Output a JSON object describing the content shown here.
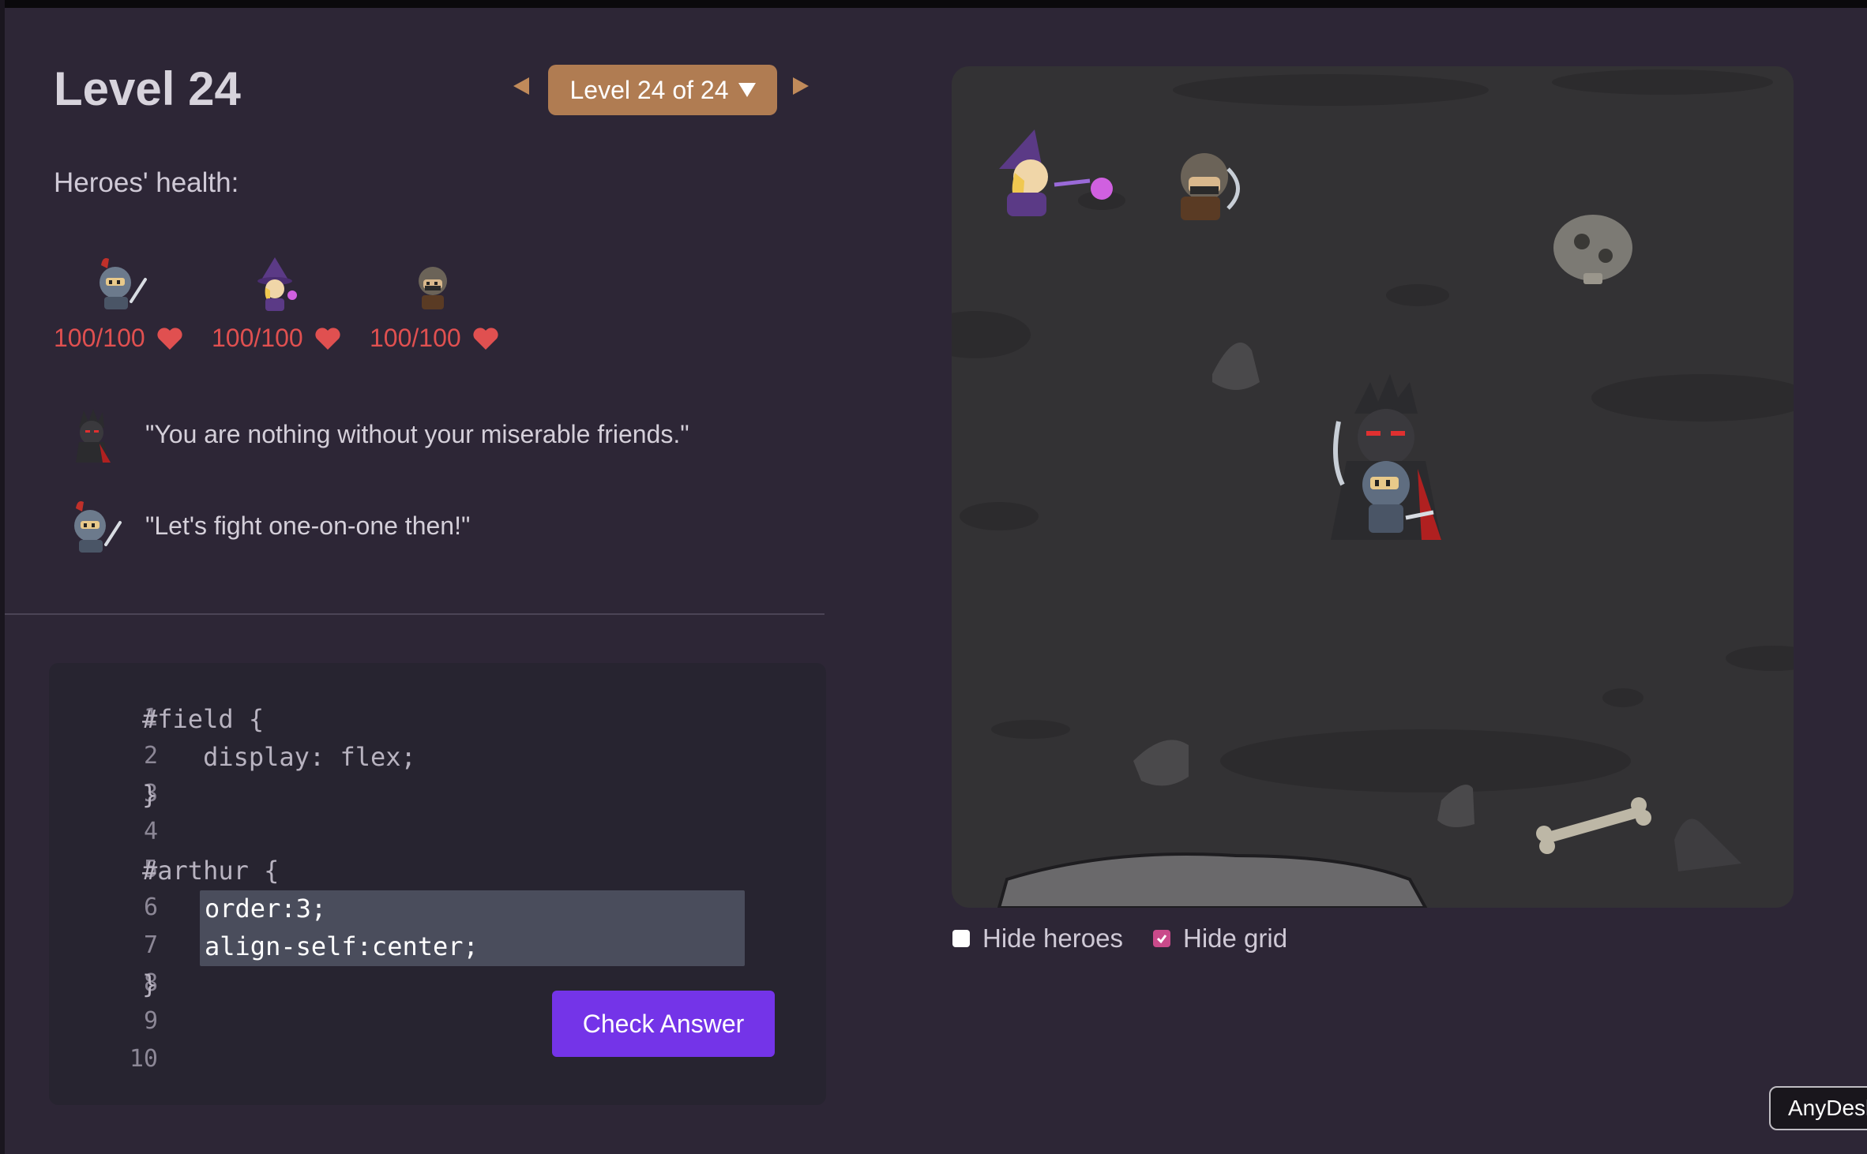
{
  "header": {
    "title": "Level 24",
    "level_selector": "Level 24 of 24"
  },
  "health": {
    "label": "Heroes' health:",
    "heroes": [
      {
        "name": "knight",
        "hp": "100/100"
      },
      {
        "name": "wizard",
        "hp": "100/100"
      },
      {
        "name": "rogue",
        "hp": "100/100"
      }
    ]
  },
  "dialogue": [
    {
      "speaker": "dark-knight",
      "text": "\"You are nothing without your miserable friends.\""
    },
    {
      "speaker": "knight",
      "text": "\"Let's fight one-on-one then!\""
    }
  ],
  "editor": {
    "line_numbers": [
      "1",
      "2",
      "3",
      "4",
      "5",
      "6",
      "7",
      "8",
      "9",
      "10"
    ],
    "code_before": [
      "#field {",
      "    display: flex;",
      "}",
      "",
      "#arthur {"
    ],
    "input_lines": [
      "order:3;",
      "align-self:center;"
    ],
    "code_after": [
      "}"
    ],
    "check_label": "Check Answer"
  },
  "controls": {
    "hide_heroes": {
      "label": "Hide heroes",
      "checked": false
    },
    "hide_grid": {
      "label": "Hide grid",
      "checked": true
    }
  },
  "tooltip": "AnyDesk",
  "colors": {
    "accent_button": "#7434e8",
    "level_selector": "#b07c52",
    "health_text": "#e05050",
    "checkbox_on": "#c94a8a"
  }
}
